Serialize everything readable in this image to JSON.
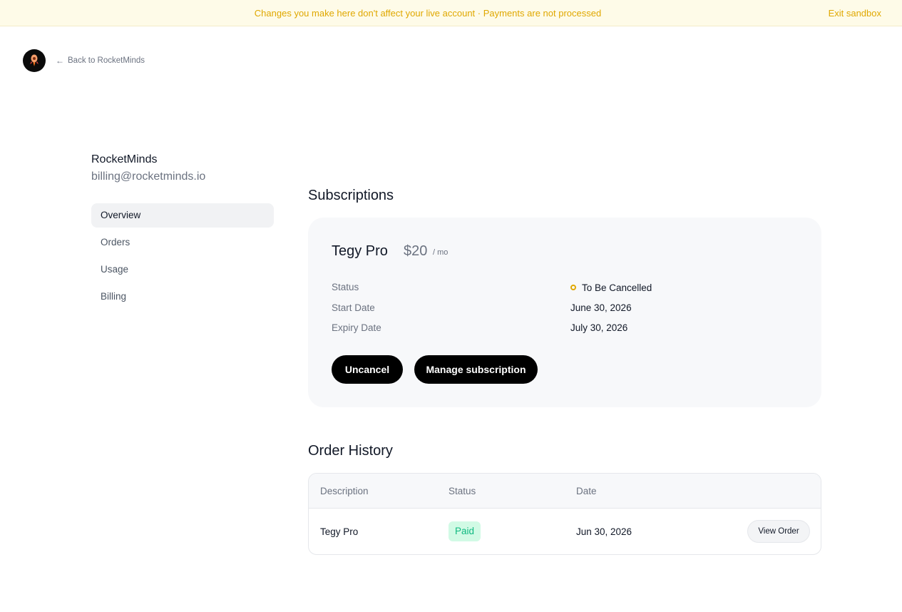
{
  "banner": {
    "message": "Changes you make here don't affect your live account · Payments are not processed",
    "exit_label": "Exit sandbox"
  },
  "header": {
    "back_label": "Back to RocketMinds"
  },
  "account": {
    "name": "RocketMinds",
    "email": "billing@rocketminds.io"
  },
  "nav": {
    "items": [
      {
        "label": "Overview",
        "active": true
      },
      {
        "label": "Orders",
        "active": false
      },
      {
        "label": "Usage",
        "active": false
      },
      {
        "label": "Billing",
        "active": false
      }
    ]
  },
  "subscriptions": {
    "title": "Subscriptions",
    "plan_name": "Tegy Pro",
    "price": "$20",
    "period": "/ mo",
    "details": {
      "status_label": "Status",
      "status_value": "To Be Cancelled",
      "start_label": "Start Date",
      "start_value": "June 30, 2026",
      "expiry_label": "Expiry Date",
      "expiry_value": "July 30, 2026"
    },
    "uncancel_label": "Uncancel",
    "manage_label": "Manage subscription"
  },
  "order_history": {
    "title": "Order History",
    "columns": [
      "Description",
      "Status",
      "Date"
    ],
    "rows": [
      {
        "description": "Tegy Pro",
        "status": "Paid",
        "date": "Jun 30, 2026",
        "action": "View Order"
      }
    ]
  },
  "colors": {
    "banner_text": "#e0a800",
    "paid_badge_bg": "#d1fae5",
    "paid_badge_text": "#10b981",
    "status_pending": "#e0a800"
  },
  "icons": {
    "logo": "rocket-icon",
    "back": "arrow-left-icon",
    "status": "status-dot-icon"
  }
}
